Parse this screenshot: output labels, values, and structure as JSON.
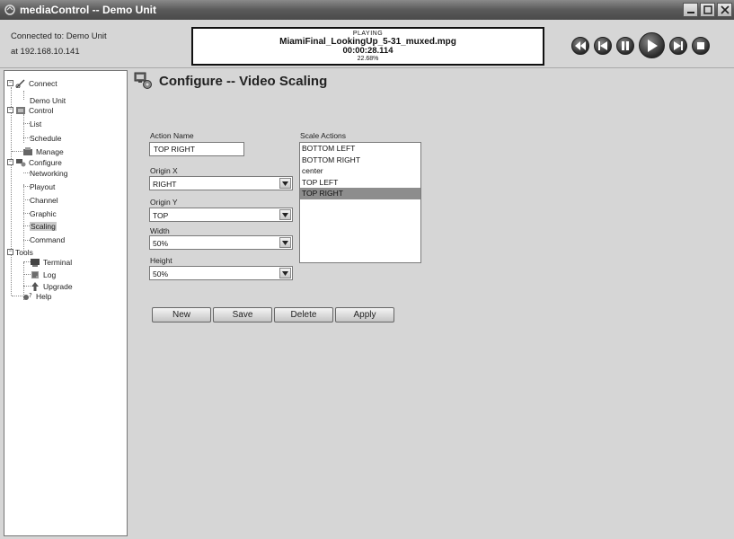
{
  "window": {
    "title": "mediaControl -- Demo Unit"
  },
  "connection": {
    "line1": "Connected to: Demo Unit",
    "line2": "at 192.168.10.141"
  },
  "now_playing": {
    "status": "PLAYING",
    "file": "MiamiFinal_LookingUp_5-31_muxed.mpg",
    "time": "00:00:28.114",
    "percent": "22.68%"
  },
  "transport": {
    "buttons": [
      "rewind-icon",
      "previous-icon",
      "pause-icon",
      "play-icon",
      "next-icon",
      "stop-icon"
    ]
  },
  "sidebar": {
    "items": [
      {
        "label": "Connect",
        "icon": "connect-icon"
      },
      {
        "label": "Demo Unit"
      },
      {
        "label": "Control",
        "icon": "control-icon"
      },
      {
        "label": "List"
      },
      {
        "label": "Schedule"
      },
      {
        "label": "Manage",
        "icon": "manage-icon"
      },
      {
        "label": "Configure",
        "icon": "configure-icon"
      },
      {
        "label": "Networking"
      },
      {
        "label": "Playout"
      },
      {
        "label": "Channel"
      },
      {
        "label": "Graphic"
      },
      {
        "label": "Scaling",
        "selected": true
      },
      {
        "label": "Command"
      },
      {
        "label": "Tools"
      },
      {
        "label": "Terminal",
        "icon": "terminal-icon"
      },
      {
        "label": "Log",
        "icon": "log-icon"
      },
      {
        "label": "Upgrade",
        "icon": "upgrade-icon"
      },
      {
        "label": "Help",
        "icon": "help-icon"
      }
    ]
  },
  "page": {
    "title": "Configure -- Video Scaling",
    "action_name_label": "Action Name",
    "action_name_value": "TOP RIGHT",
    "origin_x_label": "Origin X",
    "origin_x_value": "RIGHT",
    "origin_y_label": "Origin Y",
    "origin_y_value": "TOP",
    "width_label": "Width",
    "width_value": "50%",
    "height_label": "Height",
    "height_value": "50%",
    "scale_actions_label": "Scale Actions",
    "scale_actions": [
      "BOTTOM LEFT",
      "BOTTOM RIGHT",
      "center",
      "TOP LEFT",
      "TOP RIGHT"
    ],
    "scale_actions_selected": "TOP RIGHT",
    "buttons": {
      "new": "New",
      "save": "Save",
      "delete": "Delete",
      "apply": "Apply"
    }
  },
  "colors": {
    "selection": "#8d8d8d",
    "background": "#d6d6d6"
  }
}
